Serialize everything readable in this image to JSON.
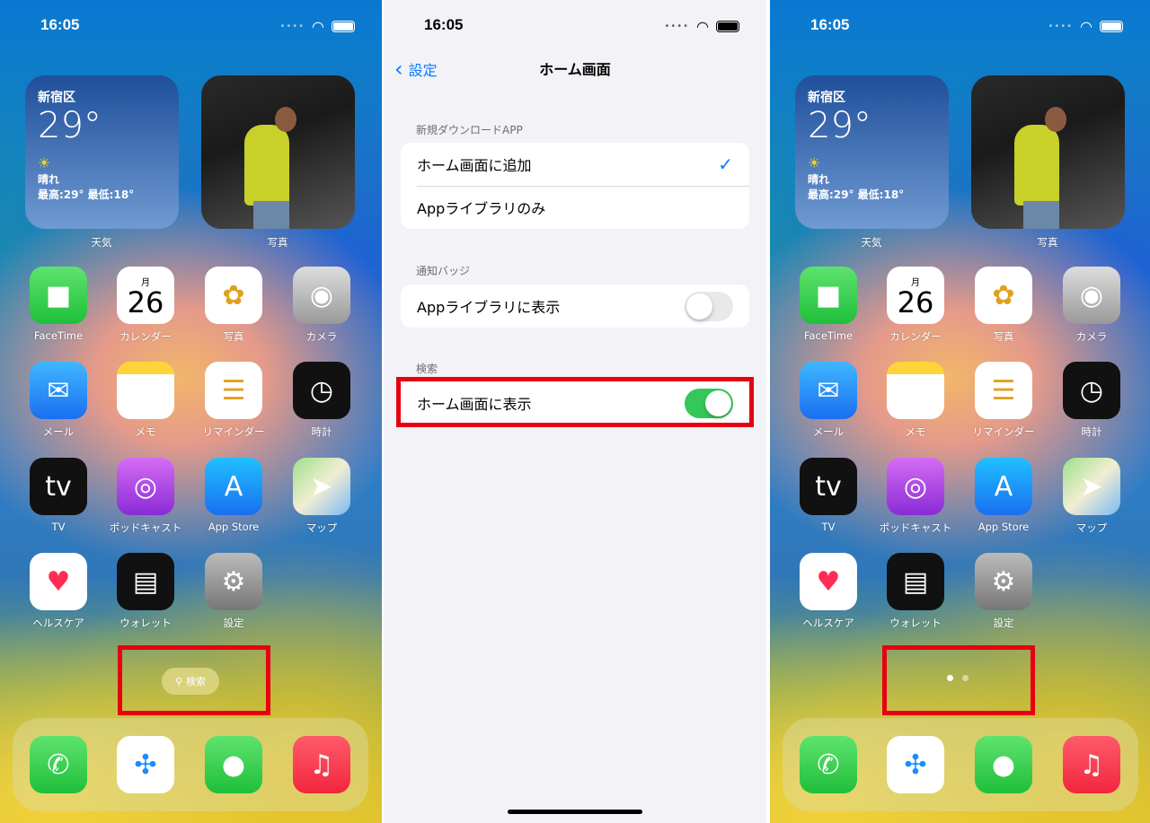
{
  "status": {
    "time": "16:05"
  },
  "colors": {
    "accent": "#0a7aff",
    "toggle_on": "#34c759",
    "highlight": "#e60012"
  },
  "home": {
    "weather": {
      "city": "新宿区",
      "temp": "29°",
      "condition": "晴れ",
      "high_low": "最高:29° 最低:18°",
      "icon": "sun-icon",
      "label": "天気"
    },
    "photos_widget": {
      "label": "写真"
    },
    "apps": [
      {
        "label": "FaceTime",
        "icon": "facetime-icon",
        "bg": "linear-gradient(#5ee36e,#1fbf3a)",
        "glyph": "■"
      },
      {
        "label": "カレンダー",
        "icon": "calendar-icon",
        "bg": "#fff",
        "month": "月",
        "day": "26"
      },
      {
        "label": "写真",
        "icon": "photos-icon",
        "bg": "#fff",
        "glyph": "✿"
      },
      {
        "label": "カメラ",
        "icon": "camera-icon",
        "bg": "linear-gradient(#ddd,#999)",
        "glyph": "◉"
      },
      {
        "label": "メール",
        "icon": "mail-icon",
        "bg": "linear-gradient(#3fb7ff,#1a6ff0)",
        "glyph": "✉"
      },
      {
        "label": "メモ",
        "icon": "notes-icon",
        "bg": "linear-gradient(#ffd43b 0 22%,#fff 22%)",
        "glyph": ""
      },
      {
        "label": "リマインダー",
        "icon": "reminders-icon",
        "bg": "#fff",
        "glyph": "☰"
      },
      {
        "label": "時計",
        "icon": "clock-icon",
        "bg": "#111",
        "glyph": "◷"
      },
      {
        "label": "TV",
        "icon": "tv-icon",
        "bg": "#111",
        "glyph": "tv"
      },
      {
        "label": "ポッドキャスト",
        "icon": "podcasts-icon",
        "bg": "linear-gradient(#d56cf4,#8a2bd6)",
        "glyph": "◎"
      },
      {
        "label": "App Store",
        "icon": "app-store-icon",
        "bg": "linear-gradient(#1fc0ff,#1a6ff0)",
        "glyph": "A"
      },
      {
        "label": "マップ",
        "icon": "maps-icon",
        "bg": "linear-gradient(135deg,#9be08a,#f2eed2 50%,#7ab8f5)",
        "glyph": "➤"
      },
      {
        "label": "ヘルスケア",
        "icon": "health-icon",
        "bg": "#fff",
        "glyph": "♥"
      },
      {
        "label": "ウォレット",
        "icon": "wallet-icon",
        "bg": "#111",
        "glyph": "▤"
      },
      {
        "label": "設定",
        "icon": "settings-icon",
        "bg": "linear-gradient(#bbb,#777)",
        "glyph": "⚙"
      }
    ],
    "dock": [
      {
        "icon": "phone-icon",
        "bg": "linear-gradient(#5ee36e,#1fbf3a)",
        "glyph": "✆"
      },
      {
        "icon": "safari-icon",
        "bg": "#fff",
        "glyph": "✣"
      },
      {
        "icon": "messages-icon",
        "bg": "linear-gradient(#5ee36e,#1fbf3a)",
        "glyph": "●"
      },
      {
        "icon": "music-icon",
        "bg": "linear-gradient(#ff5b6b,#f2263e)",
        "glyph": "♫"
      }
    ],
    "search_label": "検索"
  },
  "settings": {
    "back_label": "設定",
    "title": "ホーム画面",
    "sections": [
      {
        "header": "新規ダウンロードAPP",
        "rows": [
          {
            "label": "ホーム画面に追加",
            "checked": true
          },
          {
            "label": "Appライブラリのみ",
            "checked": false
          }
        ]
      },
      {
        "header": "通知バッジ",
        "rows": [
          {
            "label": "Appライブラリに表示",
            "toggle": false
          }
        ]
      },
      {
        "header": "検索",
        "rows": [
          {
            "label": "ホーム画面に表示",
            "toggle": true
          }
        ]
      }
    ]
  }
}
